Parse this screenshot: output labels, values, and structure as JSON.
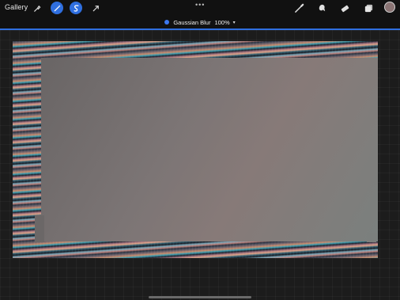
{
  "toolbar": {
    "gallery_label": "Gallery",
    "left_tools": [
      {
        "icon": "wrench-icon",
        "active": false
      },
      {
        "icon": "magic-wand-icon",
        "active": true
      },
      {
        "icon": "selection-icon",
        "active": true
      },
      {
        "icon": "transform-arrow-icon",
        "active": false
      }
    ],
    "more_icon": "ellipsis-icon",
    "right_tools": [
      "brush-icon",
      "smudge-icon",
      "eraser-icon",
      "layers-icon"
    ],
    "color_swatch": "#8a7474",
    "accent": "#2f6fe0"
  },
  "adjustment": {
    "name": "Gaussian Blur",
    "value": "100%",
    "caret": "▾"
  },
  "canvas": {
    "blur_color": "#7a7474"
  }
}
